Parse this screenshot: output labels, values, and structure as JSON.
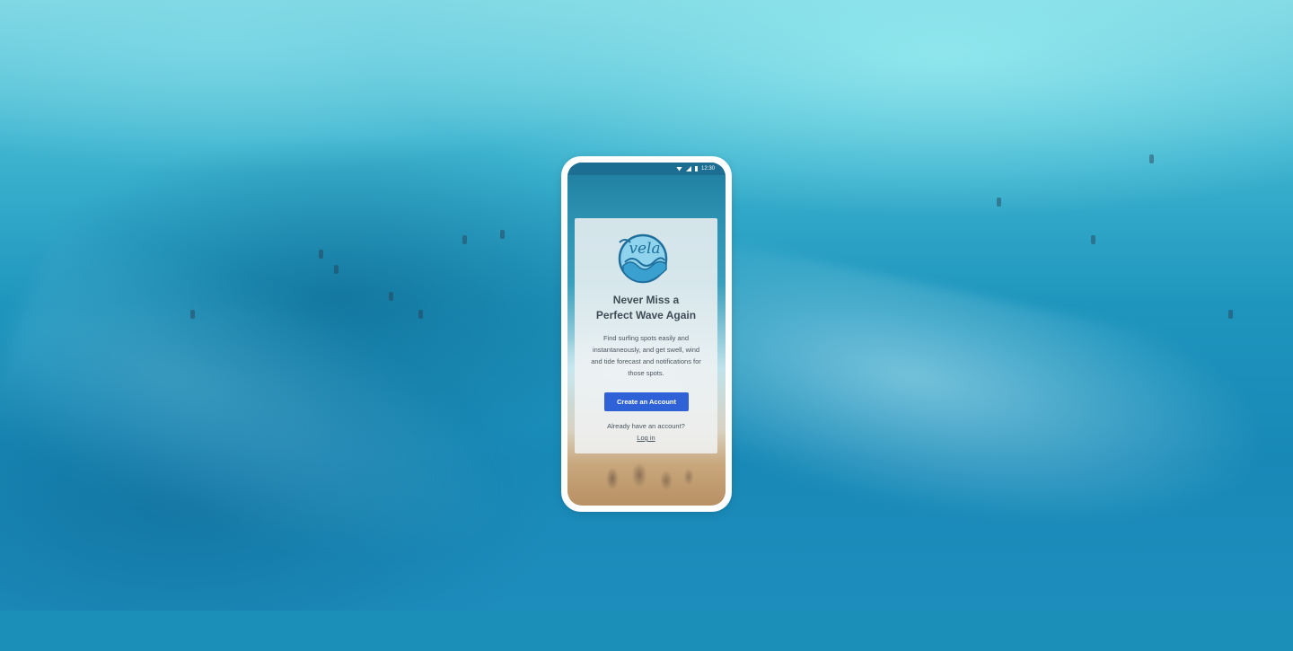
{
  "status_bar": {
    "time": "12:30",
    "icons": [
      "wifi-icon",
      "signal-icon",
      "battery-icon"
    ]
  },
  "card": {
    "logo_text": "vela",
    "title_line1": "Never Miss a",
    "title_line2": "Perfect Wave Again",
    "description": "Find surfing spots easily and instantaneously, and get swell, wind and tide forecast and notifications for those spots.",
    "primary_button_label": "Create an Account",
    "account_prompt": "Already have an account?",
    "login_link_label": "Log in"
  },
  "colors": {
    "primary_button": "#2f62d6",
    "logo_blue": "#1f7fb0",
    "status_bar_bg": "#1c6f92"
  }
}
